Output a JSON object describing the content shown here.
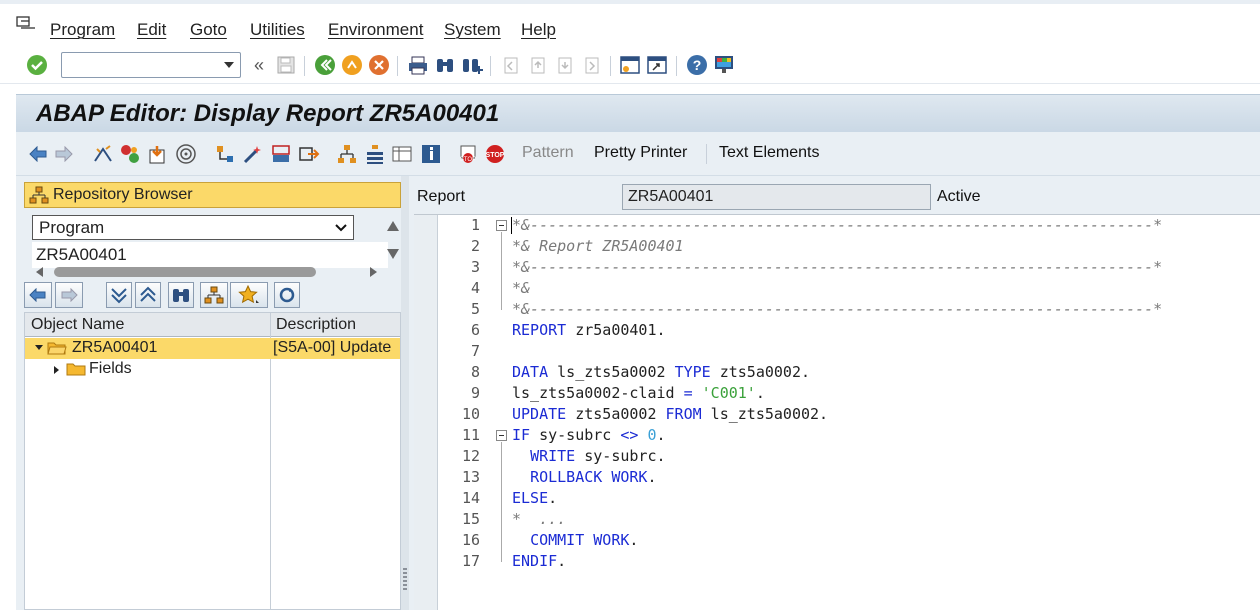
{
  "menubar": {
    "items": [
      "Program",
      "Edit",
      "Goto",
      "Utilities",
      "Environment",
      "System",
      "Help"
    ]
  },
  "toolbar": {
    "command_value": "",
    "icons": [
      "enter-icon",
      "back-nav-icon",
      "save-icon",
      "back-icon",
      "exit-icon",
      "cancel-icon",
      "print-icon",
      "find-icon",
      "find-next-icon",
      "first-page-icon",
      "prev-page-icon",
      "next-page-icon",
      "last-page-icon",
      "new-session-icon",
      "shortcut-icon",
      "help-icon",
      "customize-icon"
    ]
  },
  "title": "ABAP Editor: Display Report ZR5A00401",
  "app_toolbar": {
    "pattern": "Pattern",
    "pretty_printer": "Pretty Printer",
    "text_elements": "Text Elements"
  },
  "left": {
    "repo_browser": "Repository Browser",
    "object_type": "Program",
    "object_name": "ZR5A00401",
    "table": {
      "col_object": "Object Name",
      "col_description": "Description",
      "rows": [
        {
          "name": "ZR5A00401",
          "description": "[S5A-00] Update",
          "expanded": true,
          "level": 0
        },
        {
          "name": "Fields",
          "description": "",
          "expanded": false,
          "level": 1
        }
      ]
    }
  },
  "header_fields": {
    "report_label": "Report",
    "report_value": "ZR5A00401",
    "status": "Active"
  },
  "editor": {
    "lines": [
      "*&---------------------------------------------------------------------*",
      "*& Report ZR5A00401",
      "*&---------------------------------------------------------------------*",
      "*&",
      "*&---------------------------------------------------------------------*",
      "REPORT zr5a00401.",
      "",
      "DATA ls_zts5a0002 TYPE zts5a0002.",
      "ls_zts5a0002-claid = 'C001'.",
      "UPDATE zts5a0002 FROM ls_zts5a0002.",
      "IF sy-subrc <> 0.",
      "  WRITE sy-subrc.",
      "  ROLLBACK WORK.",
      "ELSE.",
      "*  ...",
      "  COMMIT WORK.",
      "ENDIF."
    ]
  },
  "colors": {
    "keyword": "#1b2bd4",
    "comment": "#7a7a7a",
    "string": "#3aa13a",
    "number": "#3aa0d6",
    "highlight": "#fbd969"
  }
}
